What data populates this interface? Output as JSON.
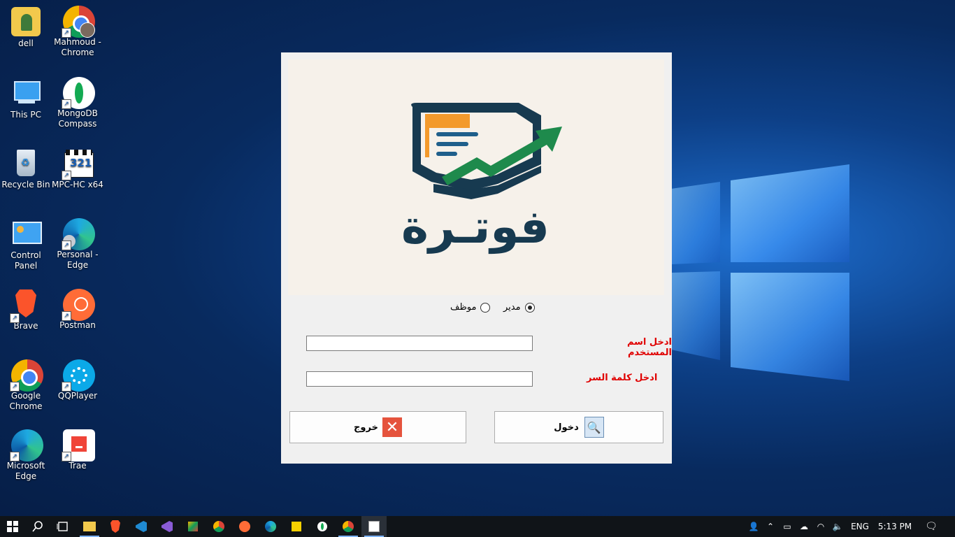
{
  "desktop": {
    "icons": [
      {
        "label": "dell",
        "icon": "user-folder-icon"
      },
      {
        "label": "Mahmoud - Chrome",
        "icon": "chrome-profile-icon"
      },
      {
        "label": "This PC",
        "icon": "computer-icon"
      },
      {
        "label": "MongoDB Compass",
        "icon": "mongodb-icon"
      },
      {
        "label": "Recycle Bin",
        "icon": "recycle-bin-icon"
      },
      {
        "label": "MPC-HC x64",
        "icon": "mpc-hc-icon"
      },
      {
        "label": "Control Panel",
        "icon": "control-panel-icon"
      },
      {
        "label": "Personal - Edge",
        "icon": "edge-profile-icon"
      },
      {
        "label": "Brave",
        "icon": "brave-icon"
      },
      {
        "label": "Postman",
        "icon": "postman-icon"
      },
      {
        "label": "Google Chrome",
        "icon": "chrome-icon"
      },
      {
        "label": "QQPlayer",
        "icon": "qqplayer-icon"
      },
      {
        "label": "Microsoft Edge",
        "icon": "edge-icon"
      },
      {
        "label": "Trae",
        "icon": "trae-icon"
      }
    ]
  },
  "login": {
    "logo_text": "فوتـرة",
    "role_manager": "مدير",
    "role_employee": "موظف",
    "username_label": "ادخل اسم المستخدم",
    "password_label": "ادخل كلمة السر",
    "username_value": "",
    "password_value": "",
    "login_button": "دخول",
    "exit_button": "خروج",
    "selected_role": "manager"
  },
  "taskbar": {
    "language": "ENG",
    "time": "5:13 PM",
    "apps": [
      "start-icon",
      "search-icon",
      "task-view-icon",
      "file-explorer-icon",
      "brave-icon",
      "vscode-icon",
      "visual-studio-icon",
      "app-icon",
      "chrome-icon",
      "postman-icon",
      "edge-icon",
      "mongodb-icon",
      "chrome-profile-icon",
      "billing-app-icon"
    ]
  },
  "colors": {
    "label_red": "#e00000",
    "logo_navy": "#173a50",
    "logo_orange": "#f39a2c",
    "logo_green": "#1e8a4c"
  }
}
